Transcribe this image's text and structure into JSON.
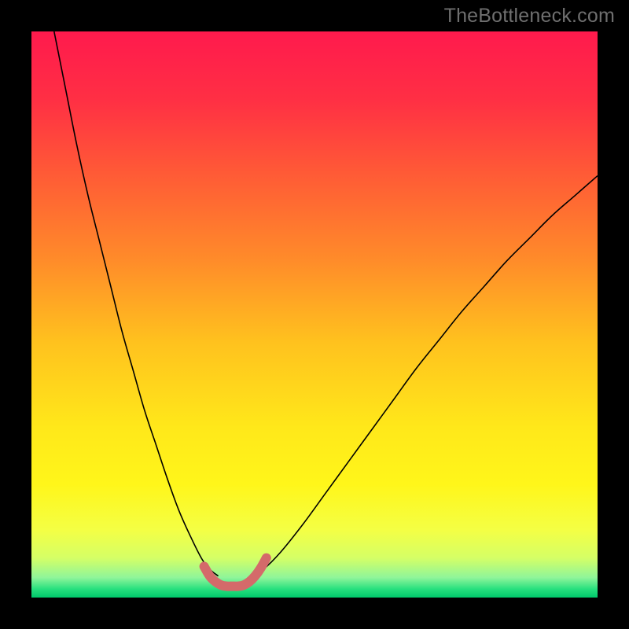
{
  "watermark": "TheBottleneck.com",
  "chart_data": {
    "type": "line",
    "title": "",
    "xlabel": "",
    "ylabel": "",
    "xlim": [
      0,
      100
    ],
    "ylim": [
      0,
      100
    ],
    "grid": false,
    "legend": null,
    "background_gradient": {
      "stops": [
        {
          "offset": 0.0,
          "color": "#ff1a4d"
        },
        {
          "offset": 0.12,
          "color": "#ff2f44"
        },
        {
          "offset": 0.25,
          "color": "#ff5a36"
        },
        {
          "offset": 0.4,
          "color": "#ff8a2a"
        },
        {
          "offset": 0.55,
          "color": "#ffc21e"
        },
        {
          "offset": 0.7,
          "color": "#ffe81a"
        },
        {
          "offset": 0.8,
          "color": "#fff61a"
        },
        {
          "offset": 0.88,
          "color": "#f4ff44"
        },
        {
          "offset": 0.93,
          "color": "#d5ff66"
        },
        {
          "offset": 0.965,
          "color": "#8ef59a"
        },
        {
          "offset": 0.985,
          "color": "#27e07e"
        },
        {
          "offset": 1.0,
          "color": "#00c96b"
        }
      ]
    },
    "series": [
      {
        "name": "left-branch",
        "color": "#000000",
        "stroke_width": 1.6,
        "x": [
          4,
          6,
          8,
          10,
          12,
          14,
          16,
          18,
          20,
          22,
          24,
          26,
          28,
          30,
          31.5,
          33
        ],
        "y": [
          100,
          90,
          80,
          71,
          63,
          55,
          47,
          40,
          33,
          27,
          21,
          15.5,
          11,
          7,
          5,
          3.8
        ]
      },
      {
        "name": "right-branch",
        "color": "#000000",
        "stroke_width": 1.6,
        "x": [
          39,
          41,
          44,
          48,
          52,
          56,
          60,
          64,
          68,
          72,
          76,
          80,
          84,
          88,
          92,
          96,
          100
        ],
        "y": [
          3.8,
          5,
          8,
          13,
          18.5,
          24,
          29.5,
          35,
          40.5,
          45.5,
          50.5,
          55,
          59.5,
          63.5,
          67.5,
          71,
          74.5
        ]
      },
      {
        "name": "bottom-highlight",
        "color": "#d46a6a",
        "stroke_width": 12,
        "linecap": "round",
        "x": [
          30.5,
          31.5,
          32.5,
          33.5,
          34.5,
          35.5,
          36.5,
          37.5,
          38.5,
          39.5,
          40.5,
          41.5
        ],
        "y": [
          5.5,
          3.8,
          2.8,
          2.2,
          2.0,
          2.0,
          2.0,
          2.2,
          2.8,
          3.8,
          5.2,
          7.0
        ]
      }
    ]
  }
}
